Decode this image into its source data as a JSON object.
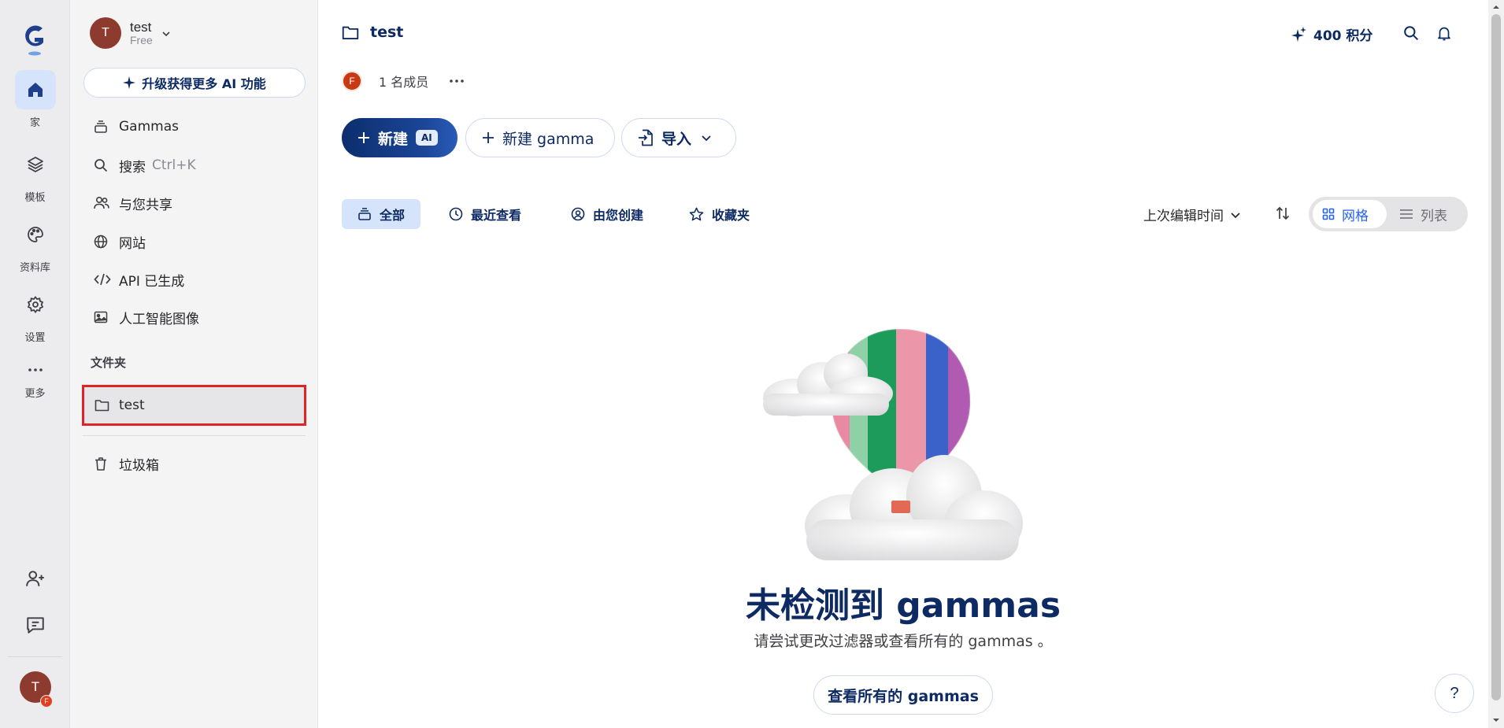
{
  "rail": {
    "items": [
      {
        "label": "家",
        "icon": "home-icon",
        "active": true
      },
      {
        "label": "模板",
        "icon": "layers-icon"
      },
      {
        "label": "资料库",
        "icon": "palette-icon"
      },
      {
        "label": "设置",
        "icon": "gear-icon"
      },
      {
        "label": "更多",
        "icon": "more-icon"
      }
    ],
    "avatar_initial": "T",
    "avatar_badge": "F"
  },
  "workspace": {
    "initial": "T",
    "name": "test",
    "plan": "Free"
  },
  "upgrade_label": "升级获得更多 AI 功能",
  "sidebar": {
    "items": [
      {
        "label": "Gammas",
        "icon": "stack-icon"
      },
      {
        "label": "搜索",
        "hint": "Ctrl+K",
        "icon": "search-icon"
      },
      {
        "label": "与您共享",
        "icon": "users-icon"
      },
      {
        "label": "网站",
        "icon": "globe-icon"
      },
      {
        "label": "API 已生成",
        "icon": "code-icon"
      },
      {
        "label": "人工智能图像",
        "icon": "image-icon"
      }
    ],
    "folders_title": "文件夹",
    "folders": [
      {
        "label": "test",
        "icon": "folder-icon"
      }
    ],
    "trash_label": "垃圾箱"
  },
  "header": {
    "title": "test",
    "credits": "400 积分",
    "members_initial": "F",
    "members_count": "1 名成员"
  },
  "actions": {
    "new_label": "新建",
    "ai_badge": "AI",
    "new_gamma_label": "新建 gamma",
    "import_label": "导入"
  },
  "filters": [
    {
      "label": "全部",
      "icon": "stack-icon",
      "active": true
    },
    {
      "label": "最近查看",
      "icon": "clock-icon"
    },
    {
      "label": "由您创建",
      "icon": "user-circle-icon"
    },
    {
      "label": "收藏夹",
      "icon": "star-icon"
    }
  ],
  "sort": {
    "label": "上次编辑时间"
  },
  "view": {
    "grid_label": "网格",
    "list_label": "列表",
    "selected": "grid"
  },
  "empty": {
    "title": "未检测到 gammas",
    "subtitle": "请尝试更改过滤器或查看所有的 gammas 。",
    "button": "查看所有的 gammas"
  },
  "help_label": "?",
  "colors": {
    "accent": "#0d2a63",
    "active_bg": "#d6e4fb",
    "link_blue": "#2563eb",
    "highlight_red": "#e02424"
  }
}
